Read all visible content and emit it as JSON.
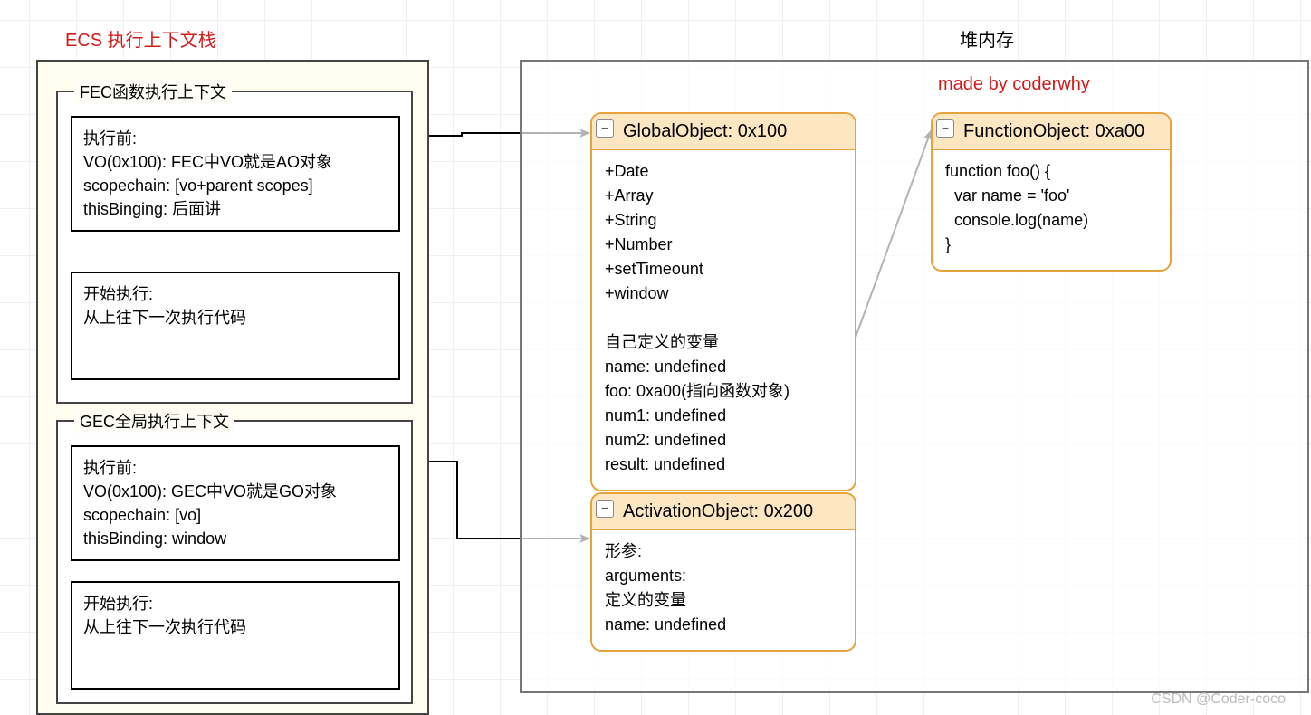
{
  "titles": {
    "ecs": "ECS 执行上下文栈",
    "heap": "堆内存",
    "made_by": "made by coderwhy"
  },
  "ecs_container": {
    "fec": {
      "label": "FEC函数执行上下文",
      "box1": "执行前:\nVO(0x100): FEC中VO就是AO对象\nscopechain: [vo+parent scopes]\nthisBinging: 后面讲",
      "box2": "开始执行:\n从上往下一次执行代码"
    },
    "gec": {
      "label": "GEC全局执行上下文",
      "box1": "执行前:\nVO(0x100): GEC中VO就是GO对象\nscopechain: [vo]\nthisBinding: window",
      "box2": "开始执行:\n从上往下一次执行代码"
    }
  },
  "heap": {
    "global": {
      "header": "GlobalObject: 0x100",
      "body": "+Date\n+Array\n+String\n+Number\n+setTimeount\n+window\n\n自己定义的变量\nname: undefined\nfoo: 0xa00(指向函数对象)\nnum1: undefined\nnum2: undefined\nresult: undefined"
    },
    "activation": {
      "header": "ActivationObject: 0x200",
      "body": "形参:\narguments:\n定义的变量\nname: undefined"
    },
    "function": {
      "header": "FunctionObject: 0xa00",
      "body": "function foo() {\n  var name = 'foo'\n  console.log(name)\n}"
    }
  },
  "icons": {
    "minus": "−"
  },
  "watermark": "CSDN @Coder-coco"
}
